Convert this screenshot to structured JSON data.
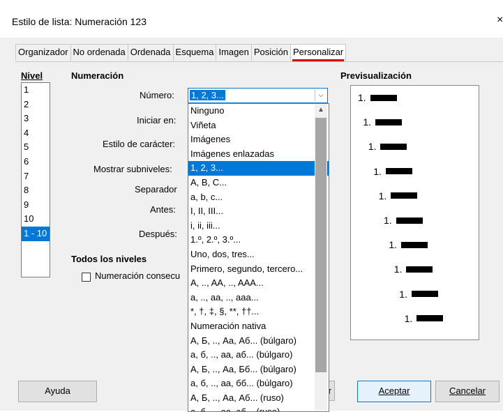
{
  "window": {
    "title": "Estilo de lista: Numeración 123",
    "close_glyph": "×"
  },
  "tabs": [
    {
      "label": "Organizador"
    },
    {
      "label": "No ordenada"
    },
    {
      "label": "Ordenada"
    },
    {
      "label": "Esquema"
    },
    {
      "label": "Imagen"
    },
    {
      "label": "Posición"
    },
    {
      "label": "Personalizar",
      "active": true
    }
  ],
  "level": {
    "heading": "Nivel",
    "items": [
      "1",
      "2",
      "3",
      "4",
      "5",
      "6",
      "7",
      "8",
      "9",
      "10",
      "1 - 10"
    ],
    "selected": "1 - 10"
  },
  "numbering": {
    "heading": "Numeración",
    "numero_label": "Número:",
    "numero_value": "1, 2, 3...",
    "iniciar_label": "Iniciar en:",
    "estilo_label": "Estilo de carácter:",
    "subniveles_label": "Mostrar subniveles:",
    "separador_label": "Separador",
    "antes_label": "Antes:",
    "despues_label": "Después:"
  },
  "all_levels": {
    "heading": "Todos los niveles",
    "consecutive_label": "Numeración consecu",
    "consecutive_checked": false
  },
  "dropdown": {
    "options": [
      "Ninguno",
      "Viñeta",
      "Imágenes",
      "Imágenes enlazadas",
      "1, 2, 3...",
      "A, B, C...",
      "a, b, c...",
      "I, II, III...",
      "i, ii, iii...",
      "1.º, 2.º, 3.º...",
      "Uno, dos, tres...",
      "Primero, segundo, tercero...",
      "A, .., AA, .., AAA...",
      "a, .., aa, .., aaa...",
      "*, †, ‡, §, **, ††...",
      "Numeración nativa",
      "А, Б, .., Аа, Аб... (búlgaro)",
      "а, б, .., аа, аб... (búlgaro)",
      "А, Б, .., Аа, Бб... (búlgaro)",
      "а, б, .., аа, бб... (búlgaro)",
      "А, Б, .., Аа, Аб... (ruso)",
      "а, б, .., аа, аб... (ruso)"
    ],
    "selected_index": 4
  },
  "preview": {
    "heading": "Previsualización",
    "number_label": "1."
  },
  "buttons": {
    "help": "Ayuda",
    "reset_fragment": "r",
    "ok": "Aceptar",
    "cancel": "Cancelar"
  },
  "colors": {
    "accent": "#0078d7",
    "active_tab_underline": "#d40000"
  },
  "icons": {
    "combo_arrow": "chevron-down-icon",
    "scroll_up": "chevron-up-icon"
  }
}
